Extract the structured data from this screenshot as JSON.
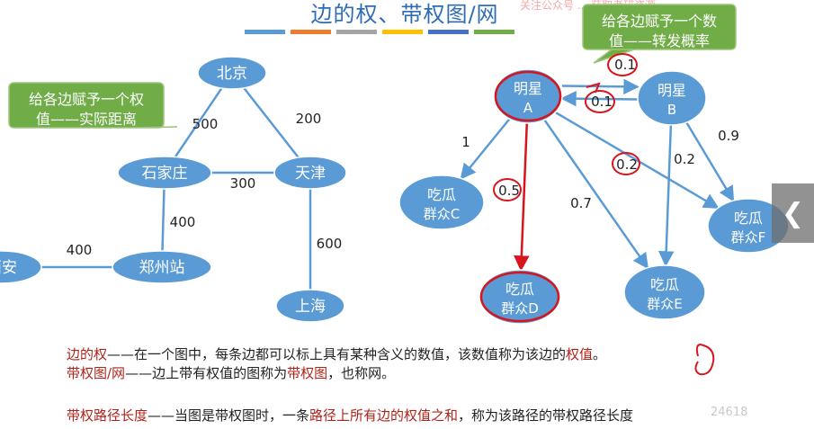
{
  "title": "边的权、带权图/网",
  "title_bar_colors": [
    "#5b9bd5",
    "#ed7d31",
    "#a5a5a5",
    "#ffc000",
    "#4472c4",
    "#70ad47"
  ],
  "watermark_top": "关注公众号 ... 获取考研资源",
  "watermark_bottom": "24618",
  "colors": {
    "node_fill": "#5b9bd5",
    "node_stroke": "#ffffff",
    "edge": "#5b9bd5",
    "callout_fill": "#70ad47",
    "callout_stroke": "#9bc57a",
    "annotation_red": "#d8141c",
    "text_red": "#b0231b"
  },
  "left_graph": {
    "callout": "给各边赋予一个权值——实际距离",
    "nodes": [
      {
        "id": "beijing",
        "label": "北京"
      },
      {
        "id": "shijiazhuang",
        "label": "石家庄"
      },
      {
        "id": "tianjin",
        "label": "天津"
      },
      {
        "id": "xian",
        "label": "西安"
      },
      {
        "id": "zhengzhou",
        "label": "郑州站"
      },
      {
        "id": "shanghai",
        "label": "上海"
      }
    ],
    "edges": [
      {
        "from": "beijing",
        "to": "shijiazhuang",
        "weight": "500"
      },
      {
        "from": "beijing",
        "to": "tianjin",
        "weight": "200"
      },
      {
        "from": "shijiazhuang",
        "to": "tianjin",
        "weight": "300"
      },
      {
        "from": "shijiazhuang",
        "to": "zhengzhou",
        "weight": "400"
      },
      {
        "from": "xian",
        "to": "zhengzhou",
        "weight": "400"
      },
      {
        "from": "tianjin",
        "to": "shanghai",
        "weight": "600"
      }
    ]
  },
  "right_graph": {
    "callout": "给各边赋予一个数值——转发概率",
    "nodes": [
      {
        "id": "A",
        "line1": "明星",
        "line2": "A"
      },
      {
        "id": "B",
        "line1": "明星",
        "line2": "B"
      },
      {
        "id": "C",
        "line1": "吃瓜",
        "line2": "群众C"
      },
      {
        "id": "D",
        "line1": "吃瓜",
        "line2": "群众D"
      },
      {
        "id": "E",
        "line1": "吃瓜",
        "line2": "群众E"
      },
      {
        "id": "F",
        "line1": "吃瓜",
        "line2": "群众F"
      }
    ],
    "edges": [
      {
        "from": "A",
        "to": "B",
        "weight": "0.1"
      },
      {
        "from": "B",
        "to": "A",
        "weight": "0.1"
      },
      {
        "from": "A",
        "to": "C",
        "weight": "1"
      },
      {
        "from": "A",
        "to": "D",
        "weight": "0.5"
      },
      {
        "from": "A",
        "to": "E",
        "weight": "0.7"
      },
      {
        "from": "A",
        "to": "F",
        "weight": "0.2"
      },
      {
        "from": "B",
        "to": "E",
        "weight": "0.2"
      },
      {
        "from": "B",
        "to": "F",
        "weight": "0.9"
      }
    ]
  },
  "definitions": {
    "line1": {
      "term": "边的权",
      "sep": "——",
      "text": "在一个图中，每条边都可以标上具有某种含义的数值，该数值称为该边的",
      "highlight": "权值",
      "end": "。"
    },
    "line2": {
      "term": "带权图/网",
      "sep": "——",
      "text": "边上带有权值的图称为",
      "highlight": "带权图",
      "end": "，也称网。"
    },
    "line3": {
      "term": "带权路径长度",
      "sep": "——",
      "text": "当图是带权图时，一条",
      "highlight": "路径上所有边的权值之和",
      "end": "，称为该路径的带权路径长度"
    }
  },
  "nav_arrow_icon": "chevron-left-icon"
}
